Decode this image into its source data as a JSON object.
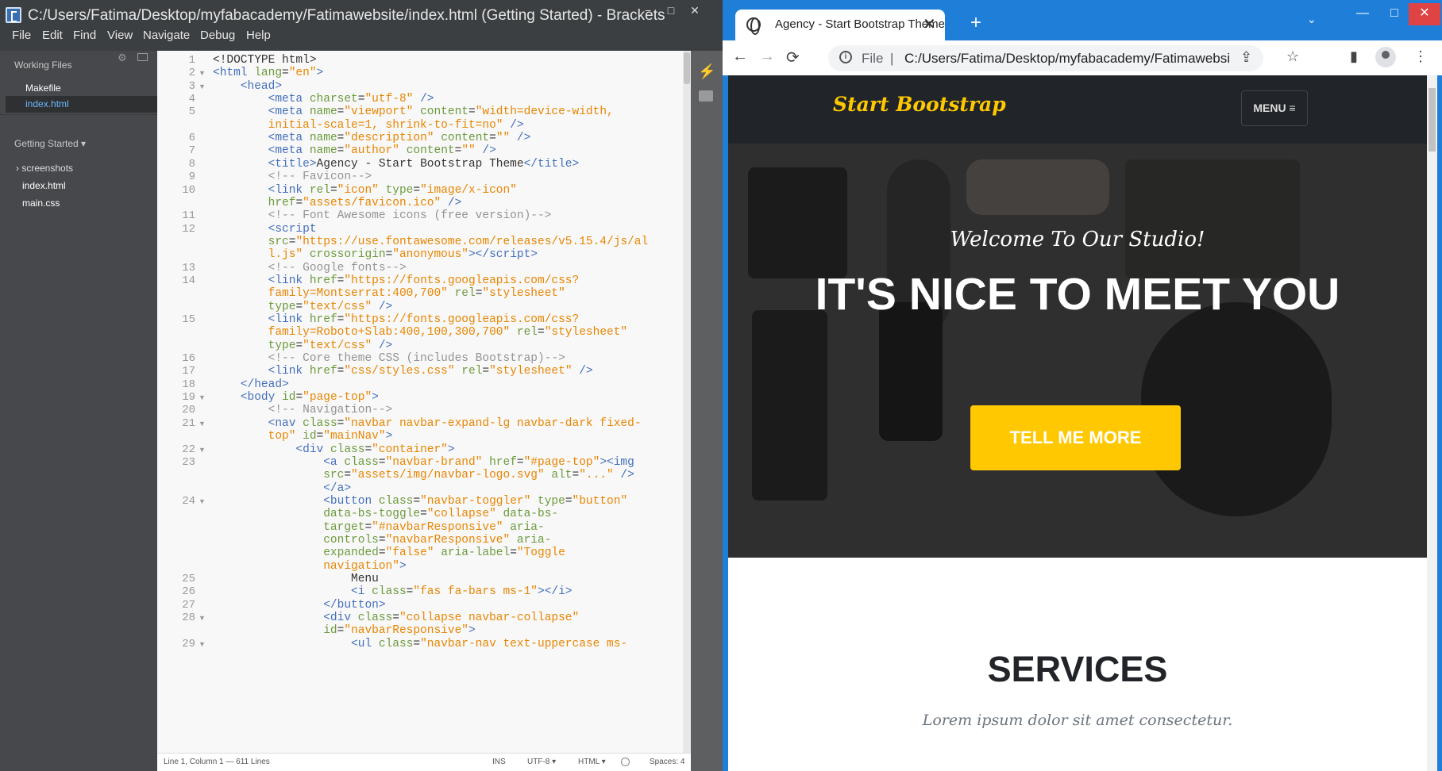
{
  "brackets": {
    "title": "C:/Users/Fatima/Desktop/myfabacademy/Fatimawebsite/index.html (Getting Started) - Brackets",
    "window_controls": [
      "−",
      "□",
      "✕"
    ],
    "menu": [
      "File",
      "Edit",
      "Find",
      "View",
      "Navigate",
      "Debug",
      "Help"
    ],
    "sidebar": {
      "working_files_label": "Working Files",
      "working_files": [
        "Makefile",
        "index.html"
      ],
      "project_label": "Getting Started ▾",
      "project_items": [
        "› screenshots",
        "index.html",
        "main.css"
      ]
    },
    "code_lines": [
      {
        "n": "1",
        "html": "<span class='txt'>&lt;!DOCTYPE html&gt;</span>"
      },
      {
        "n": "2",
        "html": "<span class='tag'>&lt;html</span> <span class='atn'>lang</span>=<span class='str'>\"en\"</span><span class='tag'>&gt;</span>"
      },
      {
        "n": "3",
        "html": "    <span class='tag'>&lt;head&gt;</span>"
      },
      {
        "n": "4",
        "html": "        <span class='tag'>&lt;meta</span> <span class='atn'>charset</span>=<span class='str'>\"utf-8\"</span> <span class='tag'>/&gt;</span>"
      },
      {
        "n": "5",
        "html": "        <span class='tag'>&lt;meta</span> <span class='atn'>name</span>=<span class='str'>\"viewport\"</span> <span class='atn'>content</span>=<span class='str'>\"width=device-width,</span>"
      },
      {
        "n": "",
        "html": "        <span class='str'>initial-scale=1, shrink-to-fit=no\"</span> <span class='tag'>/&gt;</span>"
      },
      {
        "n": "6",
        "html": "        <span class='tag'>&lt;meta</span> <span class='atn'>name</span>=<span class='str'>\"description\"</span> <span class='atn'>content</span>=<span class='str'>\"\"</span> <span class='tag'>/&gt;</span>"
      },
      {
        "n": "7",
        "html": "        <span class='tag'>&lt;meta</span> <span class='atn'>name</span>=<span class='str'>\"author\"</span> <span class='atn'>content</span>=<span class='str'>\"\"</span> <span class='tag'>/&gt;</span>"
      },
      {
        "n": "8",
        "html": "        <span class='tag'>&lt;title&gt;</span><span class='txt'>Agency - Start Bootstrap Theme</span><span class='tag'>&lt;/title&gt;</span>"
      },
      {
        "n": "9",
        "html": "        <span class='cmt'>&lt;!-- Favicon--&gt;</span>"
      },
      {
        "n": "10",
        "html": "        <span class='tag'>&lt;link</span> <span class='atn'>rel</span>=<span class='str'>\"icon\"</span> <span class='atn'>type</span>=<span class='str'>\"image/x-icon\"</span>"
      },
      {
        "n": "",
        "html": "        <span class='atn'>href</span>=<span class='str'>\"assets/favicon.ico\"</span> <span class='tag'>/&gt;</span>"
      },
      {
        "n": "11",
        "html": "        <span class='cmt'>&lt;!-- Font Awesome icons (free version)--&gt;</span>"
      },
      {
        "n": "12",
        "html": "        <span class='tag'>&lt;script</span>"
      },
      {
        "n": "",
        "html": "        <span class='atn'>src</span>=<span class='str'>\"https://use.fontawesome.com/releases/v5.15.4/js/al</span>"
      },
      {
        "n": "",
        "html": "        <span class='str'>l.js\"</span> <span class='atn'>crossorigin</span>=<span class='str'>\"anonymous\"</span><span class='tag'>&gt;&lt;/script&gt;</span>"
      },
      {
        "n": "13",
        "html": "        <span class='cmt'>&lt;!-- Google fonts--&gt;</span>"
      },
      {
        "n": "14",
        "html": "        <span class='tag'>&lt;link</span> <span class='atn'>href</span>=<span class='str'>\"https://fonts.googleapis.com/css?</span>"
      },
      {
        "n": "",
        "html": "        <span class='str'>family=Montserrat:400,700\"</span> <span class='atn'>rel</span>=<span class='str'>\"stylesheet\"</span>"
      },
      {
        "n": "",
        "html": "        <span class='atn'>type</span>=<span class='str'>\"text/css\"</span> <span class='tag'>/&gt;</span>"
      },
      {
        "n": "15",
        "html": "        <span class='tag'>&lt;link</span> <span class='atn'>href</span>=<span class='str'>\"https://fonts.googleapis.com/css?</span>"
      },
      {
        "n": "",
        "html": "        <span class='str'>family=Roboto+Slab:400,100,300,700\"</span> <span class='atn'>rel</span>=<span class='str'>\"stylesheet\"</span>"
      },
      {
        "n": "",
        "html": "        <span class='atn'>type</span>=<span class='str'>\"text/css\"</span> <span class='tag'>/&gt;</span>"
      },
      {
        "n": "16",
        "html": "        <span class='cmt'>&lt;!-- Core theme CSS (includes Bootstrap)--&gt;</span>"
      },
      {
        "n": "17",
        "html": "        <span class='tag'>&lt;link</span> <span class='atn'>href</span>=<span class='str'>\"css/styles.css\"</span> <span class='atn'>rel</span>=<span class='str'>\"stylesheet\"</span> <span class='tag'>/&gt;</span>"
      },
      {
        "n": "18",
        "html": "    <span class='tag'>&lt;/head&gt;</span>"
      },
      {
        "n": "19",
        "html": "    <span class='tag'>&lt;body</span> <span class='atn'>id</span>=<span class='str'>\"page-top\"</span><span class='tag'>&gt;</span>"
      },
      {
        "n": "20",
        "html": "        <span class='cmt'>&lt;!-- Navigation--&gt;</span>"
      },
      {
        "n": "21",
        "html": "        <span class='tag'>&lt;nav</span> <span class='atn'>class</span>=<span class='str'>\"navbar navbar-expand-lg navbar-dark fixed-</span>"
      },
      {
        "n": "",
        "html": "        <span class='str'>top\"</span> <span class='atn'>id</span>=<span class='str'>\"mainNav\"</span><span class='tag'>&gt;</span>"
      },
      {
        "n": "22",
        "html": "            <span class='tag'>&lt;div</span> <span class='atn'>class</span>=<span class='str'>\"container\"</span><span class='tag'>&gt;</span>"
      },
      {
        "n": "23",
        "html": "                <span class='tag'>&lt;a</span> <span class='atn'>class</span>=<span class='str'>\"navbar-brand\"</span> <span class='atn'>href</span>=<span class='str'>\"#page-top\"</span><span class='tag'>&gt;&lt;img</span>"
      },
      {
        "n": "",
        "html": "                <span class='atn'>src</span>=<span class='str'>\"assets/img/navbar-logo.svg\"</span> <span class='atn'>alt</span>=<span class='str'>\"...\"</span> <span class='tag'>/&gt;</span>"
      },
      {
        "n": "",
        "html": "                <span class='tag'>&lt;/a&gt;</span>"
      },
      {
        "n": "24",
        "html": "                <span class='tag'>&lt;button</span> <span class='atn'>class</span>=<span class='str'>\"navbar-toggler\"</span> <span class='atn'>type</span>=<span class='str'>\"button\"</span>"
      },
      {
        "n": "",
        "html": "                <span class='atn'>data-bs-toggle</span>=<span class='str'>\"collapse\"</span> <span class='atn'>data-bs-</span>"
      },
      {
        "n": "",
        "html": "                <span class='atn'>target</span>=<span class='str'>\"#navbarResponsive\"</span> <span class='atn'>aria-</span>"
      },
      {
        "n": "",
        "html": "                <span class='atn'>controls</span>=<span class='str'>\"navbarResponsive\"</span> <span class='atn'>aria-</span>"
      },
      {
        "n": "",
        "html": "                <span class='atn'>expanded</span>=<span class='str'>\"false\"</span> <span class='atn'>aria-label</span>=<span class='str'>\"Toggle</span>"
      },
      {
        "n": "",
        "html": "                <span class='str'>navigation\"</span><span class='tag'>&gt;</span>"
      },
      {
        "n": "25",
        "html": "                    <span class='txt'>Menu</span>"
      },
      {
        "n": "26",
        "html": "                    <span class='tag'>&lt;i</span> <span class='atn'>class</span>=<span class='str'>\"fas fa-bars ms-1\"</span><span class='tag'>&gt;&lt;/i&gt;</span>"
      },
      {
        "n": "27",
        "html": "                <span class='tag'>&lt;/button&gt;</span>"
      },
      {
        "n": "28",
        "html": "                <span class='tag'>&lt;div</span> <span class='atn'>class</span>=<span class='str'>\"collapse navbar-collapse\"</span>"
      },
      {
        "n": "",
        "html": "                <span class='atn'>id</span>=<span class='str'>\"navbarResponsive\"</span><span class='tag'>&gt;</span>"
      },
      {
        "n": "29",
        "html": "                    <span class='tag'>&lt;ul</span> <span class='atn'>class</span>=<span class='str'>\"navbar-nav text-uppercase ms-</span>"
      }
    ],
    "fold_lines": [
      "2",
      "3",
      "19",
      "21",
      "22",
      "24",
      "28",
      "29"
    ],
    "status": {
      "position": "Line 1, Column 1 — 611 Lines",
      "ins": "INS",
      "encoding": "UTF-8 ▾",
      "language": "HTML ▾",
      "spaces": "Spaces: 4"
    }
  },
  "chrome": {
    "tab_title": "Agency - Start Bootstrap Theme",
    "tab_close": "✕",
    "new_tab": "+",
    "tab_dropdown": "⌄",
    "window_controls": [
      "—",
      "□",
      "✕"
    ],
    "nav": {
      "back": "←",
      "forward": "→",
      "reload": "⟳"
    },
    "omnibox": {
      "scheme": "File",
      "separator": "|",
      "url": "C:/Users/Fatima/Desktop/myfabacademy/Fatimawebsite/index..."
    },
    "toolbar_icons": {
      "share": "⇪",
      "star": "☆",
      "sidepanel": "▮",
      "menu": "⋮"
    }
  },
  "page": {
    "brand": "Start Bootstrap",
    "menu_label": "MENU ≡",
    "hero_subheading": "Welcome To Our Studio!",
    "hero_heading": "IT'S NICE TO MEET YOU",
    "hero_button": "TELL ME MORE",
    "services_title": "SERVICES",
    "services_subtitle": "Lorem ipsum dolor sit amet consectetur."
  },
  "colors": {
    "accent": "#ffc800",
    "navbar_bg": "#212529",
    "chrome_frame": "#1f7fd8"
  }
}
